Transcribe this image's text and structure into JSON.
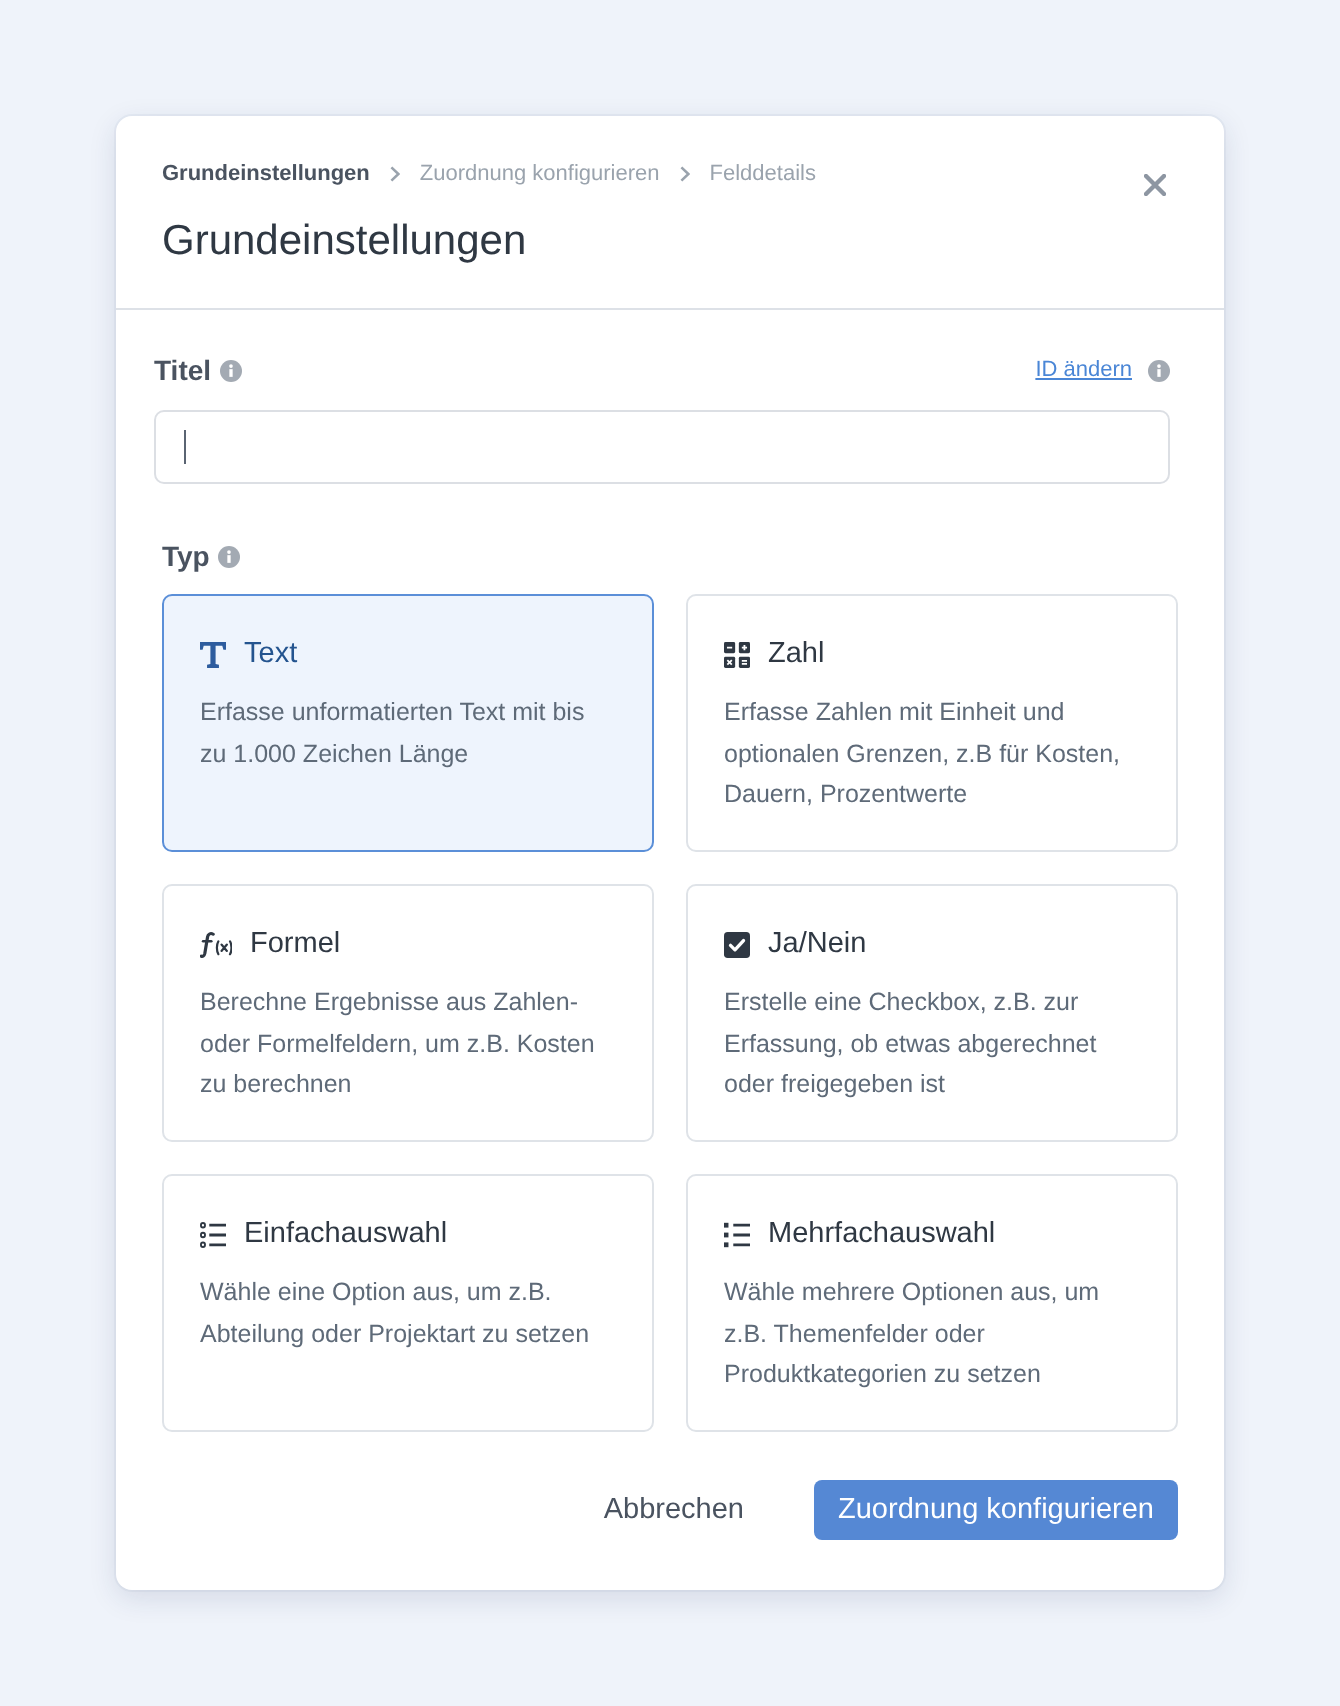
{
  "breadcrumb": [
    {
      "label": "Grundeinstellungen",
      "current": true
    },
    {
      "label": "Zuordnung konfigurieren",
      "current": false
    },
    {
      "label": "Felddetails",
      "current": false
    }
  ],
  "title": "Grundeinstellungen",
  "title_field": {
    "label": "Titel",
    "link": "ID ändern",
    "focused": true
  },
  "type_field": {
    "label": "Typ",
    "options": [
      {
        "kind": "text",
        "label": "Text",
        "description": "Erfasse unformatierten Text mit bis zu 1.000 Zeichen Länge",
        "selected": true
      },
      {
        "kind": "number",
        "label": "Zahl",
        "description": "Erfasse Zahlen mit Einheit und optionalen Grenzen, z.B für Kosten, Dauern, Prozentwerte",
        "selected": false
      },
      {
        "kind": "formula",
        "label": "Formel",
        "description": "Berechne Ergebnisse aus Zahlen- oder Formelfeldern, um z.B. Kosten zu berechnen",
        "selected": false
      },
      {
        "kind": "boolean",
        "label": "Ja/Nein",
        "description": "Erstelle eine Checkbox, z.B. zur Erfassung, ob etwas abgerechnet oder freigegeben ist",
        "selected": false
      },
      {
        "kind": "single_choice",
        "label": "Einfachauswahl",
        "description": "Wähle eine Option aus, um z.B. Abteilung oder Projektart zu setzen",
        "selected": false
      },
      {
        "kind": "multiple_choice",
        "label": "Mehrfachauswahl",
        "description": "Wähle mehrere Optionen aus, um z.B. Themenfelder oder Produktkategorien zu setzen",
        "selected": false
      }
    ]
  },
  "buttons": [
    {
      "kind": "secondary",
      "label": "Abbrechen"
    },
    {
      "kind": "primary",
      "label": "Zuordnung konfigurieren"
    }
  ]
}
